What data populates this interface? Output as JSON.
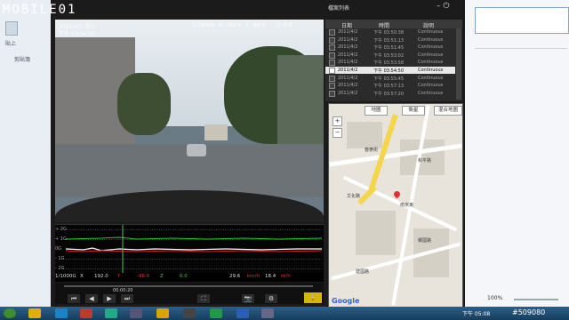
{
  "logo": "MOBILE01",
  "player": {
    "window_controls": "– ⏻",
    "osd": {
      "date": "2011/4/2 週六",
      "time": "下午 03:54:50",
      "g_label": "1/1000G",
      "x_val": "X: 192.0",
      "y_val": "Y: -96.0",
      "z_val": "Z: 0.0"
    },
    "graph": {
      "labels": [
        "+ 2G",
        "+ 1G",
        "0G",
        "- 1G",
        "- 2G"
      ]
    },
    "infobar": {
      "g_unit": "1/1000G",
      "x": "X",
      "x_value": "192.0",
      "y": "Y",
      "y_value": "-96.0",
      "z": "Z",
      "z_value": "0.0",
      "speed": "29.6",
      "speed_unit": "km/h",
      "speed2": "18.4",
      "speed2_unit": "m/h"
    },
    "control": {
      "time_left": "00:00:20",
      "buttons": [
        "⏮",
        "◀",
        "▶",
        "⏭",
        "⛶",
        "📷",
        "⚙"
      ],
      "lock_label": "🔒"
    }
  },
  "file_list": {
    "title": "檔案列表",
    "headers": [
      "日期",
      "時間",
      "說明"
    ],
    "rows": [
      {
        "date": "2011/4/2",
        "time": "下午 03:50:38",
        "desc": "Continuous"
      },
      {
        "date": "2011/4/2",
        "time": "下午 03:51:13",
        "desc": "Continuous"
      },
      {
        "date": "2011/4/2",
        "time": "下午 03:51:45",
        "desc": "Continuous"
      },
      {
        "date": "2011/4/2",
        "time": "下午 03:53:02",
        "desc": "Continuous"
      },
      {
        "date": "2011/4/2",
        "time": "下午 03:53:58",
        "desc": "Continuous"
      },
      {
        "date": "2011/4/2",
        "time": "下午 03:54:50",
        "desc": "Continuous",
        "selected": true
      },
      {
        "date": "2011/4/2",
        "time": "下午 03:55:45",
        "desc": "Continuous"
      },
      {
        "date": "2011/4/2",
        "time": "下午 03:57:13",
        "desc": "Continuous"
      },
      {
        "date": "2011/4/2",
        "time": "下午 03:57:20",
        "desc": "Continuous"
      }
    ]
  },
  "map": {
    "tabs": [
      "地圖",
      "衛星",
      "混合地圖"
    ],
    "zoom_in": "+",
    "zoom_out": "−",
    "labels": [
      "春麥街",
      "和平路",
      "文化路",
      "南京東",
      "鄉國路",
      "建國路"
    ],
    "google": "Google"
  },
  "background": {
    "ribbon_labels": [
      "貼上",
      "剪貼簿"
    ],
    "zoom_level": "100%"
  },
  "taskbar": {
    "clock": "下午 05:08",
    "date": "2011/4/4"
  },
  "watermark": "#509080"
}
